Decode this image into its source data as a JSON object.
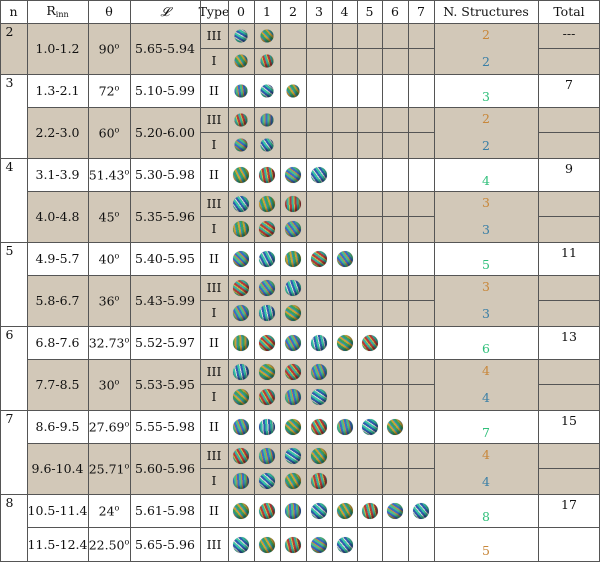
{
  "header": {
    "n": "n",
    "rinn": "R",
    "rinn_sub": "inn",
    "theta": "θ",
    "L": "𝓛",
    "type": "Type",
    "cols": [
      "0",
      "1",
      "2",
      "3",
      "4",
      "5",
      "6",
      "7"
    ],
    "nstruct": "N. Structures",
    "total": "Total"
  },
  "rows": [
    {
      "n": "2",
      "r": "1.0-1.2",
      "theta": "90",
      "L": "5.65-5.94",
      "types": [
        "III",
        "I"
      ],
      "balls": [
        2,
        2
      ],
      "counts": [
        "2",
        "2"
      ],
      "total": "---"
    },
    {
      "n": "3",
      "r": "1.3-2.1",
      "theta": "72",
      "L": "5.10-5.99",
      "types": [
        "II"
      ],
      "balls": [
        3
      ],
      "counts": [
        "3"
      ],
      "total": "7"
    },
    {
      "n": "",
      "r": "2.2-3.0",
      "theta": "60",
      "L": "5.20-6.00",
      "types": [
        "III",
        "I"
      ],
      "balls": [
        2,
        2
      ],
      "counts": [
        "2",
        "2"
      ],
      "total": ""
    },
    {
      "n": "4",
      "r": "3.1-3.9",
      "theta": "51.43",
      "L": "5.30-5.98",
      "types": [
        "II"
      ],
      "balls": [
        4
      ],
      "counts": [
        "4"
      ],
      "total": "9"
    },
    {
      "n": "",
      "r": "4.0-4.8",
      "theta": "45",
      "L": "5.35-5.96",
      "types": [
        "III",
        "I"
      ],
      "balls": [
        3,
        3
      ],
      "counts": [
        "3",
        "3"
      ],
      "total": ""
    },
    {
      "n": "5",
      "r": "4.9-5.7",
      "theta": "40",
      "L": "5.40-5.95",
      "types": [
        "II"
      ],
      "balls": [
        5
      ],
      "counts": [
        "5"
      ],
      "total": "11"
    },
    {
      "n": "",
      "r": "5.8-6.7",
      "theta": "36",
      "L": "5.43-5.99",
      "types": [
        "III",
        "I"
      ],
      "balls": [
        3,
        3
      ],
      "counts": [
        "3",
        "3"
      ],
      "total": ""
    },
    {
      "n": "6",
      "r": "6.8-7.6",
      "theta": "32.73",
      "L": "5.52-5.97",
      "types": [
        "II"
      ],
      "balls": [
        6
      ],
      "counts": [
        "6"
      ],
      "total": "13"
    },
    {
      "n": "",
      "r": "7.7-8.5",
      "theta": "30",
      "L": "5.53-5.95",
      "types": [
        "III",
        "I"
      ],
      "balls": [
        4,
        4
      ],
      "counts": [
        "4",
        "4"
      ],
      "total": ""
    },
    {
      "n": "7",
      "r": "8.6-9.5",
      "theta": "27.69",
      "L": "5.55-5.98",
      "types": [
        "II"
      ],
      "balls": [
        7
      ],
      "counts": [
        "7"
      ],
      "total": "15"
    },
    {
      "n": "",
      "r": "9.6-10.4",
      "theta": "25.71",
      "L": "5.60-5.96",
      "types": [
        "III",
        "I"
      ],
      "balls": [
        4,
        4
      ],
      "counts": [
        "4",
        "4"
      ],
      "total": ""
    },
    {
      "n": "8",
      "r": "10.5-11.4",
      "theta": "24",
      "L": "5.61-5.98",
      "types": [
        "II"
      ],
      "balls": [
        8
      ],
      "counts": [
        "8"
      ],
      "total": "17"
    },
    {
      "n": "",
      "r": "11.5-12.4",
      "theta": "22.50",
      "L": "5.65-5.96",
      "types": [
        "III"
      ],
      "balls": [
        5
      ],
      "counts": [
        "5"
      ],
      "total": ""
    }
  ],
  "degree_symbol": "o",
  "colors": {
    "shade": "#d2c8b8",
    "type_III_count": "#c8873a",
    "type_I_count": "#3a7fa6",
    "type_II_count": "#2fbf7a"
  }
}
